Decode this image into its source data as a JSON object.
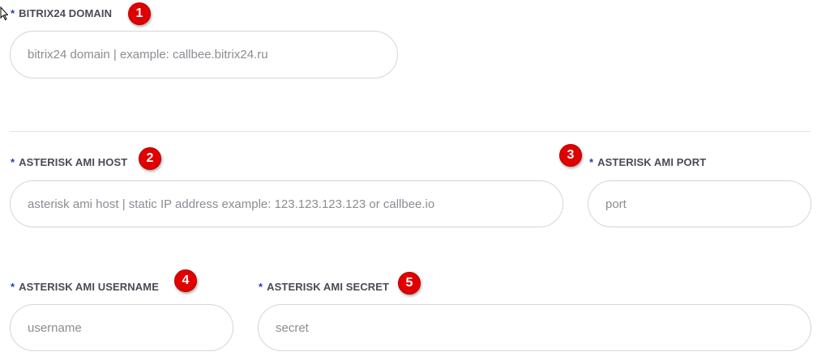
{
  "required_mark": "*",
  "fields": {
    "bitrix_domain": {
      "label": "BITRIX24 DOMAIN",
      "placeholder": "bitrix24 domain | example: callbee.bitrix24.ru",
      "value": ""
    },
    "ami_host": {
      "label": "ASTERISK AMI HOST",
      "placeholder": "asterisk ami host | static IP address example: 123.123.123.123 or callbee.io",
      "value": ""
    },
    "ami_port": {
      "label": "ASTERISK AMI PORT",
      "placeholder": "port",
      "value": ""
    },
    "ami_username": {
      "label": "ASTERISK AMI USERNAME",
      "placeholder": "username",
      "value": ""
    },
    "ami_secret": {
      "label": "ASTERISK AMI SECRET",
      "placeholder": "secret",
      "value": ""
    }
  },
  "markers": [
    "1",
    "2",
    "3",
    "4",
    "5"
  ],
  "colors": {
    "required_mark": "#2b3bb5",
    "label_text": "#4a4a55",
    "marker_bg": "#e00000",
    "field_border": "#d5d5dc",
    "placeholder": "#8c8c93"
  },
  "icons": {
    "cursor": "mouse-pointer-icon"
  }
}
